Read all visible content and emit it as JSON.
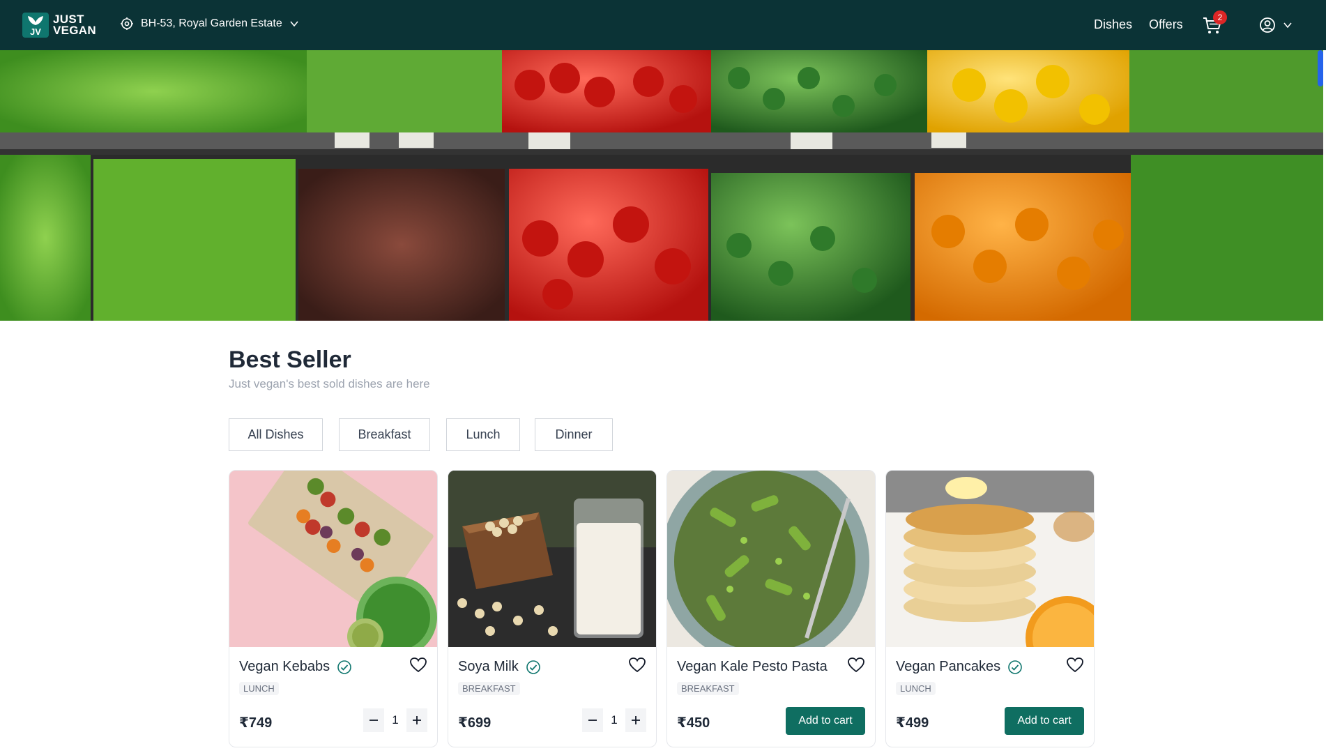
{
  "header": {
    "logo_line1": "JUST",
    "logo_line2": "VEGAN",
    "logo_badge": "JV",
    "location": "BH-53, Royal Garden Estate",
    "nav": {
      "dishes": "Dishes",
      "offers": "Offers"
    },
    "cart_count": "2"
  },
  "section": {
    "title": "Best Seller",
    "subtitle": "Just vegan's best sold dishes are here",
    "filters": [
      "All Dishes",
      "Breakfast",
      "Lunch",
      "Dinner"
    ]
  },
  "products": [
    {
      "name": "Vegan Kebabs",
      "verified": true,
      "tag": "LUNCH",
      "price": "₹749",
      "quantity": "1",
      "action": "quantity"
    },
    {
      "name": "Soya Milk",
      "verified": true,
      "tag": "BREAKFAST",
      "price": "₹699",
      "quantity": "1",
      "action": "quantity"
    },
    {
      "name": "Vegan Kale Pesto Pasta",
      "verified": false,
      "tag": "BREAKFAST",
      "price": "₹450",
      "action": "add",
      "add_label": "Add to cart"
    },
    {
      "name": "Vegan Pancakes",
      "verified": true,
      "tag": "LUNCH",
      "price": "₹499",
      "action": "add",
      "add_label": "Add to cart"
    }
  ],
  "colors": {
    "header_bg": "#0b3336",
    "accent": "#0f6e61",
    "badge": "#dc2626"
  },
  "icons": [
    "location-pin-icon",
    "chevron-down-icon",
    "cart-icon",
    "user-circle-icon",
    "verified-check-icon",
    "heart-icon",
    "minus-icon",
    "plus-icon"
  ]
}
